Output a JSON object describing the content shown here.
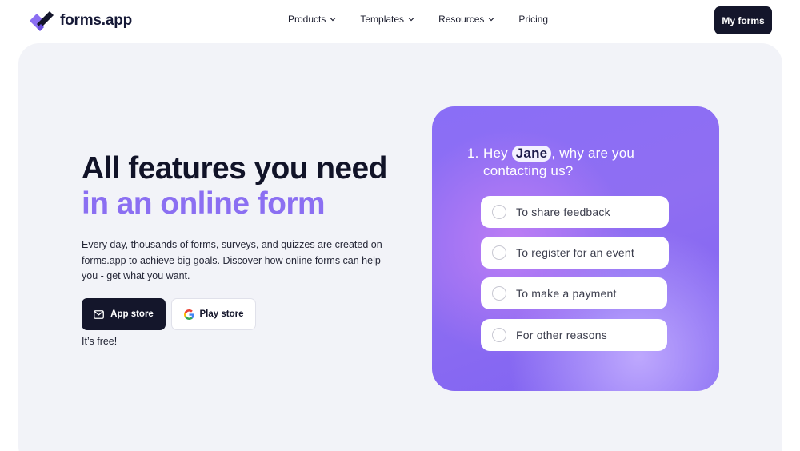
{
  "header": {
    "logo_text": "forms.app",
    "nav": [
      {
        "label": "Products",
        "has_dropdown": true
      },
      {
        "label": "Templates",
        "has_dropdown": true
      },
      {
        "label": "Resources",
        "has_dropdown": true
      },
      {
        "label": "Pricing",
        "has_dropdown": false
      }
    ],
    "cta_label": "My forms"
  },
  "hero": {
    "title_line1": "All features you need",
    "title_line2": "in an online form",
    "description": "Every day, thousands of forms, surveys, and quizzes are created on forms.app to achieve big goals. Discover how online forms can help you - get what you want.",
    "app_store_label": "App store",
    "play_store_label": "Play store",
    "free_note": "It’s free!"
  },
  "form_card": {
    "question_number": "1.",
    "question_prefix": "Hey",
    "question_name": "Jane",
    "question_suffix": ", why are you contacting us?",
    "options": [
      "To share feedback",
      "To register for an event",
      "To make a payment",
      "For other reasons"
    ]
  },
  "colors": {
    "brand_dark": "#14162b",
    "accent_purple": "#8b6ff2",
    "panel_bg": "#f2f3f8"
  },
  "icons": {
    "logo": "forms-app-logo-icon",
    "chevron": "chevron-down-icon",
    "app_store": "mail-icon",
    "play_store": "google-icon"
  }
}
